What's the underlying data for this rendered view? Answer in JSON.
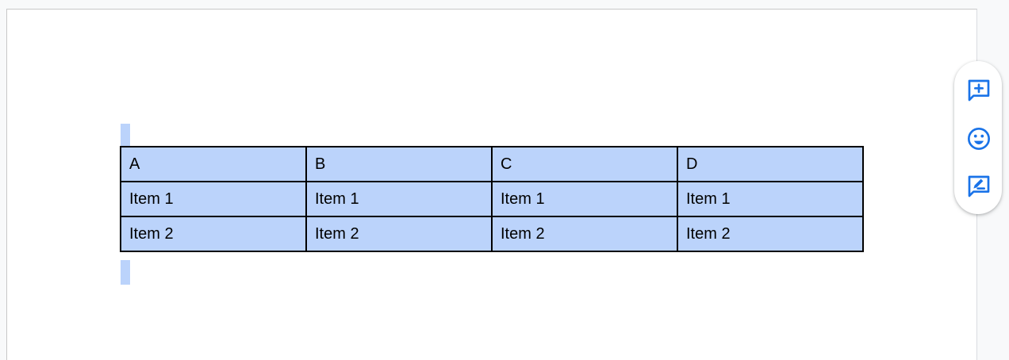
{
  "table": {
    "rows": [
      [
        "A",
        "B",
        "C",
        "D"
      ],
      [
        "Item 1",
        "Item 1",
        "Item 1",
        "Item 1"
      ],
      [
        "Item 2",
        "Item 2",
        "Item 2",
        "Item 2"
      ]
    ]
  },
  "side_toolbar": {
    "buttons": [
      {
        "icon": "add-comment-icon"
      },
      {
        "icon": "emoji-icon"
      },
      {
        "icon": "suggest-edit-icon"
      }
    ],
    "icon_color": "#1a73e8"
  },
  "colors": {
    "selection": "#bbd3fb",
    "table_border": "#000000",
    "page_background": "#ffffff"
  }
}
